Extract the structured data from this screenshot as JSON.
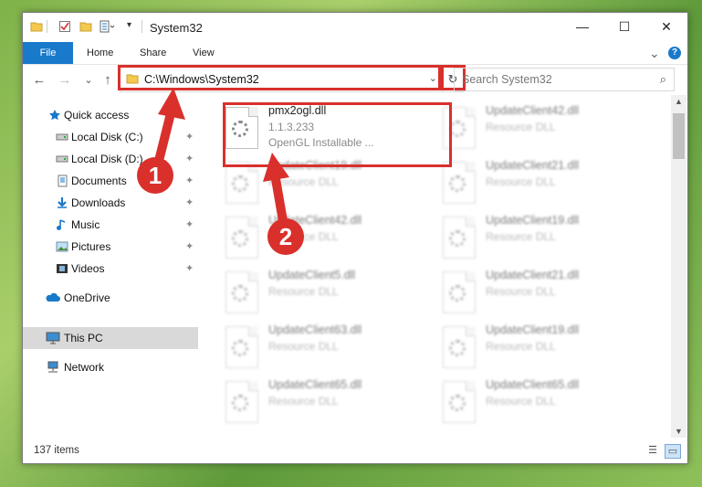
{
  "window": {
    "title": "System32",
    "minimize_glyph": "—",
    "maximize_glyph": "☐",
    "close_glyph": "✕"
  },
  "ribbon": {
    "tabs": [
      "File",
      "Home",
      "Share",
      "View"
    ],
    "expand_glyph": "⌄",
    "help_glyph": "?"
  },
  "nav": {
    "back_glyph": "←",
    "forward_glyph": "→",
    "recent_glyph": "⌄",
    "up_glyph": "↑"
  },
  "address": {
    "path": "C:\\Windows\\System32",
    "dropdown_glyph": "⌄",
    "refresh_glyph": "↻"
  },
  "search": {
    "placeholder": "Search System32",
    "icon_glyph": "⌕"
  },
  "sidebar": {
    "items": [
      {
        "label": "Quick access",
        "icon": "star-icon"
      },
      {
        "label": "Local Disk (C:)",
        "icon": "drive-icon"
      },
      {
        "label": "Local Disk (D:)",
        "icon": "drive-icon"
      },
      {
        "label": "Documents",
        "icon": "documents-icon"
      },
      {
        "label": "Downloads",
        "icon": "download-icon"
      },
      {
        "label": "Music",
        "icon": "music-icon"
      },
      {
        "label": "Pictures",
        "icon": "pictures-icon"
      },
      {
        "label": "Videos",
        "icon": "videos-icon"
      },
      {
        "label": "OneDrive",
        "icon": "cloud-icon"
      },
      {
        "label": "This PC",
        "icon": "computer-icon"
      },
      {
        "label": "Network",
        "icon": "network-icon"
      }
    ],
    "pin_glyph": "📌"
  },
  "files": [
    {
      "name": "pmx2ogl.dll",
      "line1": "1.1.3.233",
      "line2": "OpenGL Installable ..."
    },
    {
      "name": "UpdateClient42.dll",
      "line1": "Resource DLL"
    },
    {
      "name": "UpdateClient19.dll",
      "line1": "Resource DLL"
    },
    {
      "name": "UpdateClient21.dll",
      "line1": "Resource DLL"
    },
    {
      "name": "UpdateClient42.dll",
      "line1": "Resource DLL"
    },
    {
      "name": "UpdateClient19.dll",
      "line1": "Resource DLL"
    },
    {
      "name": "UpdateClient5.dll",
      "line1": "Resource DLL"
    },
    {
      "name": "UpdateClient21.dll",
      "line1": "Resource DLL"
    },
    {
      "name": "UpdateClient63.dll",
      "line1": "Resource DLL"
    },
    {
      "name": "UpdateClient19.dll",
      "line1": "Resource DLL"
    },
    {
      "name": "UpdateClient65.dll",
      "line1": "Resource DLL"
    },
    {
      "name": "UpdateClient65.dll",
      "line1": "Resource DLL"
    }
  ],
  "status": {
    "item_count": "137 items"
  },
  "annotations": {
    "step1": "1",
    "step2": "2",
    "color": "#d9302c"
  }
}
